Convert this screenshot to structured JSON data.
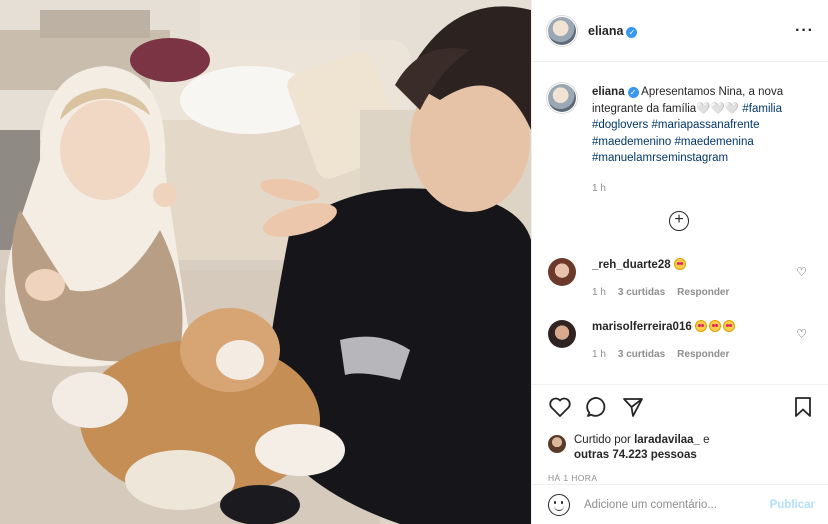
{
  "photo": {
    "alt": ""
  },
  "header": {
    "username": "eliana",
    "more_icon": "ellipsis-icon"
  },
  "caption": {
    "username": "eliana",
    "text": "Apresentamos Nina, a nova integrante da família🤍🤍🤍",
    "hashtags": [
      "#familia",
      "#doglovers",
      "#mariapassanafrente",
      "#maedemenino",
      "#maedemenina",
      "#manuelamrseminstagram"
    ],
    "time": "1 h"
  },
  "load_more_icon": "plus-circle-icon",
  "comments": [
    {
      "username": "_reh_duarte28",
      "emoji_count": 1,
      "time": "1 h",
      "likes": "3 curtidas",
      "reply": "Responder"
    },
    {
      "username": "marisolferreira016",
      "emoji_count": 3,
      "time": "1 h",
      "likes": "3 curtidas",
      "reply": "Responder"
    }
  ],
  "liked_by": {
    "prefix": "Curtido por",
    "user": "laradavilaa_",
    "and": "e",
    "others": "outras 74.223 pessoas"
  },
  "post_age": "HÁ 1 HORA",
  "add_comment": {
    "placeholder": "Adicione um comentário...",
    "publish": "Publicar"
  },
  "colors": {
    "link": "#00376b",
    "verified": "#3897f0",
    "publish_disabled": "#b2dffc",
    "meta": "#8e8e8e"
  }
}
